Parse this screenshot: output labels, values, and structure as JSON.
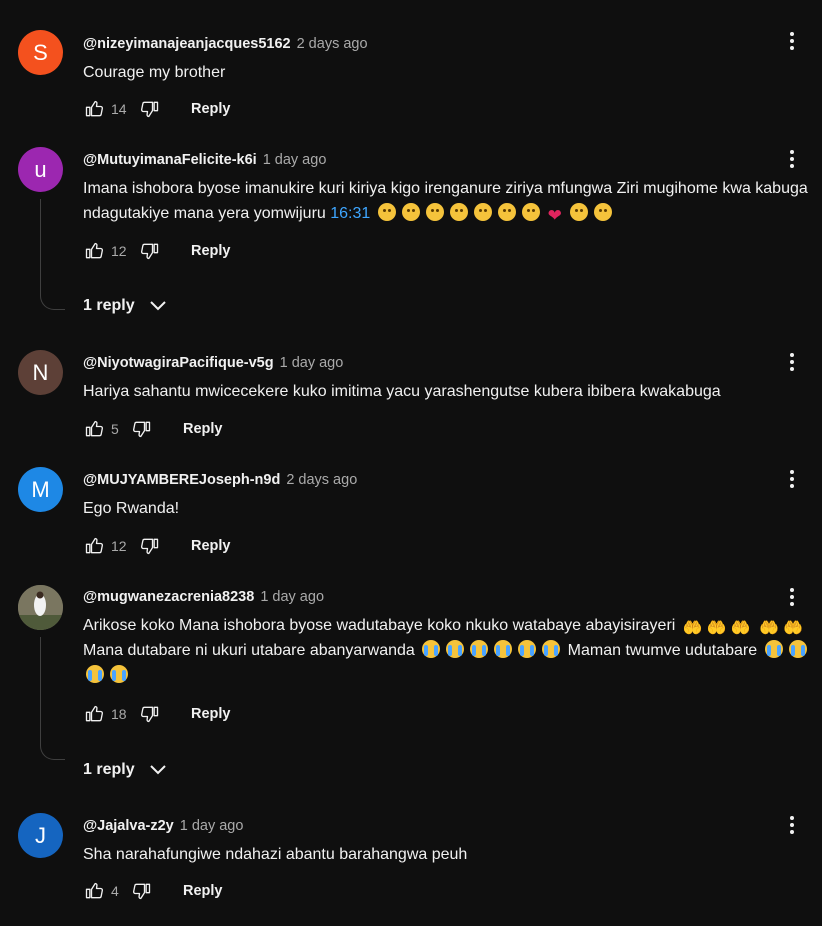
{
  "comments": [
    {
      "handle": "@nizeyimanajeanjacques5162",
      "time": "2 days ago",
      "avatar_letter": "S",
      "avatar_color": "#f4511e",
      "text": "Courage my brother",
      "likes": "14",
      "reply_label": "Reply"
    },
    {
      "handle": "@MutuyimanaFelicite-k6i",
      "time": "1 day ago",
      "avatar_letter": "u",
      "avatar_color": "#9c27b0",
      "text_a": "Imana ishobora byose imanukire kuri kiriya kigo irenganure ziriya mfungwa Ziri mugihome kwa kabuga ndagutakiye mana yera yomwijuru ",
      "timestamp": "16:31",
      "likes": "12",
      "reply_label": "Reply",
      "replies_label": "1 reply"
    },
    {
      "handle": "@NiyotwagiraPacifique-v5g",
      "time": "1 day ago",
      "avatar_letter": "N",
      "avatar_color": "#5d4037",
      "text": "Hariya sahantu mwicecekere kuko imitima yacu yarashengutse kubera ibibera kwakabuga",
      "likes": "5",
      "reply_label": "Reply"
    },
    {
      "handle": "@MUJYAMBEREJoseph-n9d",
      "time": "2 days ago",
      "avatar_letter": "M",
      "avatar_color": "#1e88e5",
      "text": "Ego Rwanda!",
      "likes": "12",
      "reply_label": "Reply"
    },
    {
      "handle": "@mugwanezacrenia8238",
      "time": "1 day ago",
      "text_a": "Arikose koko Mana ishobora byose wadutabaye koko nkuko watabaye abayisirayeri ",
      "text_b": " Mana dutabare ni ukuri utabare abanyarwanda ",
      "text_c": " Maman twumve udutabare ",
      "likes": "18",
      "reply_label": "Reply",
      "replies_label": "1 reply"
    },
    {
      "handle": "@Jajalva-z2y",
      "time": "1 day ago",
      "avatar_letter": "J",
      "avatar_color": "#1565c0",
      "text": "Sha narahafungiwe ndahazi abantu barahangwa peuh",
      "likes": "4",
      "reply_label": "Reply"
    }
  ]
}
